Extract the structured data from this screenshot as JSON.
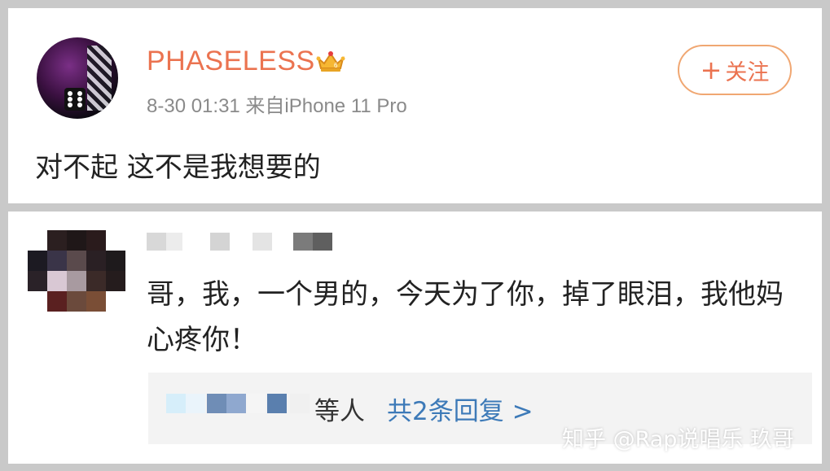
{
  "post": {
    "username": "PHASELESS",
    "badge_icon": "crown-icon",
    "meta": "8-30 01:31  来自iPhone 11 Pro",
    "follow_label": "关注",
    "follow_plus": "+",
    "text": "对不起 这不是我想要的"
  },
  "comment": {
    "text": "哥，我，一个男的，今天为了你，掉了眼泪，我他妈心疼你！",
    "replies_suffix": "等人",
    "replies_link": "共2条回复 >"
  },
  "watermark": "知乎 @Rap说唱乐 玖哥",
  "colors": {
    "username": "#eb7350",
    "follow_border": "#f0a772",
    "link": "#3d7ab8",
    "background": "#c9c9c9"
  }
}
